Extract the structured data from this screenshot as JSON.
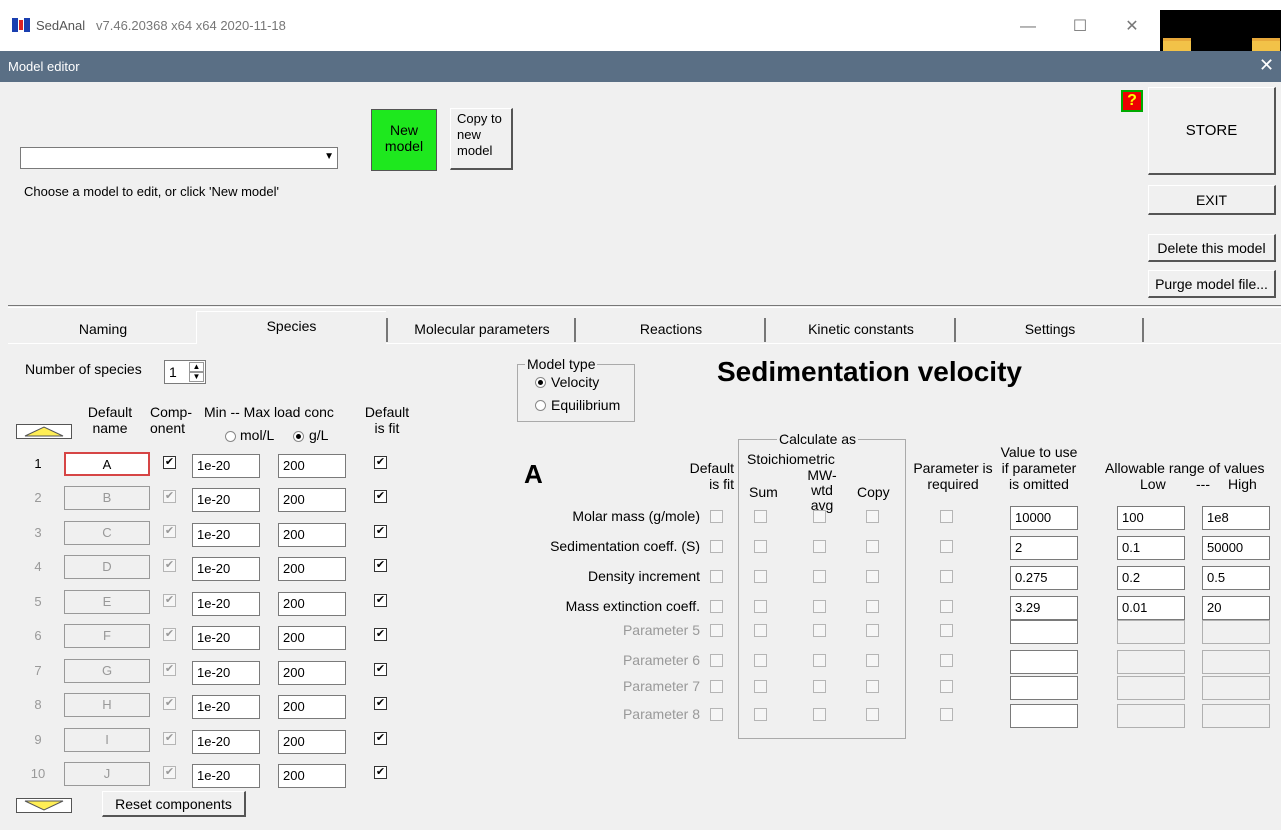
{
  "app": {
    "title": "SedAnal",
    "version": "v7.46.20368 x64 x64 2020-11-18",
    "window_controls": {
      "minimize": "—",
      "maximize": "☐",
      "close": "✕"
    }
  },
  "dialog": {
    "title": "Model editor",
    "close": "✕"
  },
  "model_select": {
    "value": "",
    "hint": "Choose a model to edit, or click 'New model'"
  },
  "buttons": {
    "new_model": "New model",
    "copy_to_new_model": "Copy to new model",
    "help": "?",
    "store": "STORE",
    "exit": "EXIT",
    "delete_model": "Delete this model",
    "purge_model_file": "Purge model file...",
    "reset_components": "Reset components"
  },
  "tabs": [
    "Naming",
    "Species",
    "Molecular parameters",
    "Reactions",
    "Kinetic constants",
    "Settings"
  ],
  "species_panel": {
    "number_label": "Number of species",
    "number_value": "1",
    "headers": {
      "default_name": "Default name",
      "component": "Comp-onent",
      "load_conc": "Min -- Max load conc",
      "default_fit": "Default is fit",
      "unit_mol": "mol/L",
      "unit_g": "g/L"
    },
    "rows": [
      {
        "num": "1",
        "name": "A",
        "min": "1e-20",
        "max": "200"
      },
      {
        "num": "2",
        "name": "B",
        "min": "1e-20",
        "max": "200"
      },
      {
        "num": "3",
        "name": "C",
        "min": "1e-20",
        "max": "200"
      },
      {
        "num": "4",
        "name": "D",
        "min": "1e-20",
        "max": "200"
      },
      {
        "num": "5",
        "name": "E",
        "min": "1e-20",
        "max": "200"
      },
      {
        "num": "6",
        "name": "F",
        "min": "1e-20",
        "max": "200"
      },
      {
        "num": "7",
        "name": "G",
        "min": "1e-20",
        "max": "200"
      },
      {
        "num": "8",
        "name": "H",
        "min": "1e-20",
        "max": "200"
      },
      {
        "num": "9",
        "name": "I",
        "min": "1e-20",
        "max": "200"
      },
      {
        "num": "10",
        "name": "J",
        "min": "1e-20",
        "max": "200"
      }
    ]
  },
  "model_type": {
    "label": "Model type",
    "options": [
      "Velocity",
      "Equilibrium"
    ],
    "selected": "Velocity",
    "heading": "Sedimentation velocity"
  },
  "params_panel": {
    "species_label": "A",
    "headers": {
      "default_fit": "Default is fit",
      "calculate_as": "Calculate as",
      "stoichiometric": "Stoichiometric",
      "sum": "Sum",
      "mw_wtd": "MW-wtd avg",
      "copy": "Copy",
      "required": "Parameter is required",
      "value_to_use": "Value to use if parameter is omitted",
      "range": "Allowable range of values",
      "low": "Low",
      "dash": "---",
      "high": "High"
    },
    "rows": [
      {
        "label": "Molar mass (g/mole)",
        "value": "10000",
        "low": "100",
        "high": "1e8"
      },
      {
        "label": "Sedimentation coeff. (S)",
        "value": "2",
        "low": "0.1",
        "high": "50000"
      },
      {
        "label": "Density increment",
        "value": "0.275",
        "low": "0.2",
        "high": "0.5"
      },
      {
        "label": "Mass extinction coeff.",
        "value": "3.29",
        "low": "0.01",
        "high": "20"
      },
      {
        "label": "Parameter 5",
        "value": "",
        "low": "",
        "high": ""
      },
      {
        "label": "Parameter 6",
        "value": "",
        "low": "",
        "high": ""
      },
      {
        "label": "Parameter 7",
        "value": "",
        "low": "",
        "high": ""
      },
      {
        "label": "Parameter 8",
        "value": "",
        "low": "",
        "high": ""
      }
    ]
  },
  "colors": {
    "new_model_bg": "#1ee81e",
    "titlebar": "#5a6f85",
    "active_name_border": "#d64545",
    "arrow_yellow": "#ffee55"
  }
}
